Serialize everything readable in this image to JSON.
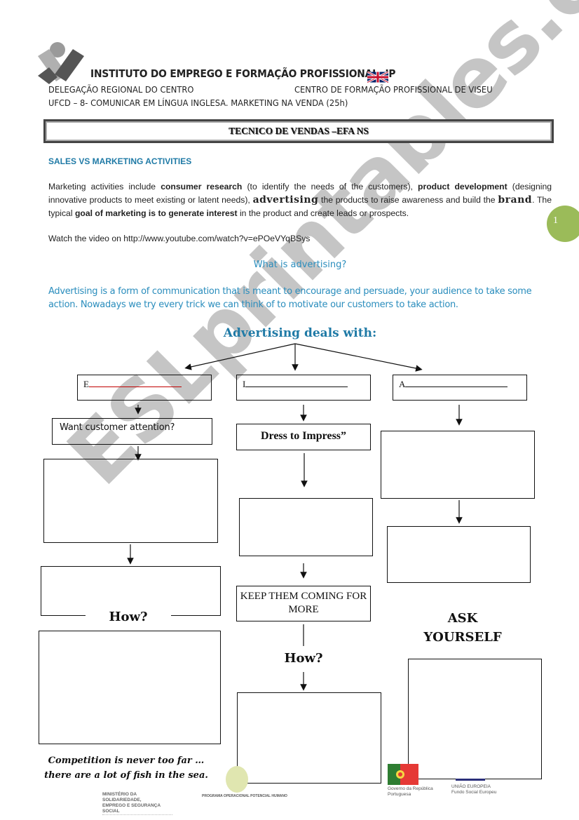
{
  "header": {
    "institute": "INSTITUTO DO EMPREGO E FORMAÇÃO PROFISSIONAL, IP",
    "delegation": "DELEGAÇÃO REGIONAL DO CENTRO",
    "center": "CENTRO DE FORMAÇÃO PROFISSIONAL DE VISEU",
    "ufcd": "UFCD – 8- COMUNICAR EM LÍNGUA INGLESA.  MARKETING NA VENDA (25h)",
    "logo_icon": "iefp-logo-icon",
    "flag_icon": "uk-flag-icon"
  },
  "title_box": "TECNICO DE VENDAS –EFA NS",
  "section_heading": "SALES VS MARKETING ACTIVITIES",
  "intro": {
    "p1": "Marketing activities include ",
    "b1": "consumer research",
    "p2": " (to identify the needs of the customers), ",
    "b2": "product development",
    "p3": " (designing innovative products to meet existing or latent needs), ",
    "f1": "advertising",
    "p4": " the products to raise awareness and build the ",
    "f2": "brand",
    "p5": ". The typical ",
    "b3": "goal of marketing is to generate interest",
    "p6": " in the product and create leads or prospects."
  },
  "video_line": "Watch the video on http://www.youtube.com/watch?v=ePOeVYqBSys",
  "page_number": "1",
  "what_is": "What is advertising?",
  "definition": "Advertising is a form of communication that is meant to encourage and persuade, your audience to take some action. Nowadays we try every trick we can think of to motivate our customers to take action.",
  "deals_heading": "Advertising deals with:",
  "flow": {
    "col1": {
      "letter": "E",
      "question": "Want customer attention?",
      "how": "How?"
    },
    "col2": {
      "letter": "I",
      "label": "Dress to Impress”",
      "keep": "KEEP THEM COMING FOR MORE",
      "how": "How?"
    },
    "col3": {
      "letter": "A",
      "ask": "ASK YOURSELF"
    }
  },
  "quote": {
    "line1": "Competition is never too far …",
    "line2": "there are a lot of fish in the sea."
  },
  "footer": {
    "ministry_line1": "MINISTÉRIO DA SOLIDARIEDADE,",
    "ministry_line2": "EMPREGO E SEGURANÇA SOCIAL",
    "poph": "PROGRAMA OPERACIONAL POTENCIAL HUMANO",
    "gov_line1": "Governo da República",
    "gov_line2": "Portuguesa",
    "eu_line1": "UNIÃO EUROPEIA",
    "eu_line2": "Fundo Social Europeu"
  },
  "watermark": "ESLprintables.com",
  "colors": {
    "accent_blue": "#1f7aa6",
    "light_blue": "#2a8dbd",
    "page_badge": "#9bbb59",
    "red_underline": "#c00000"
  }
}
